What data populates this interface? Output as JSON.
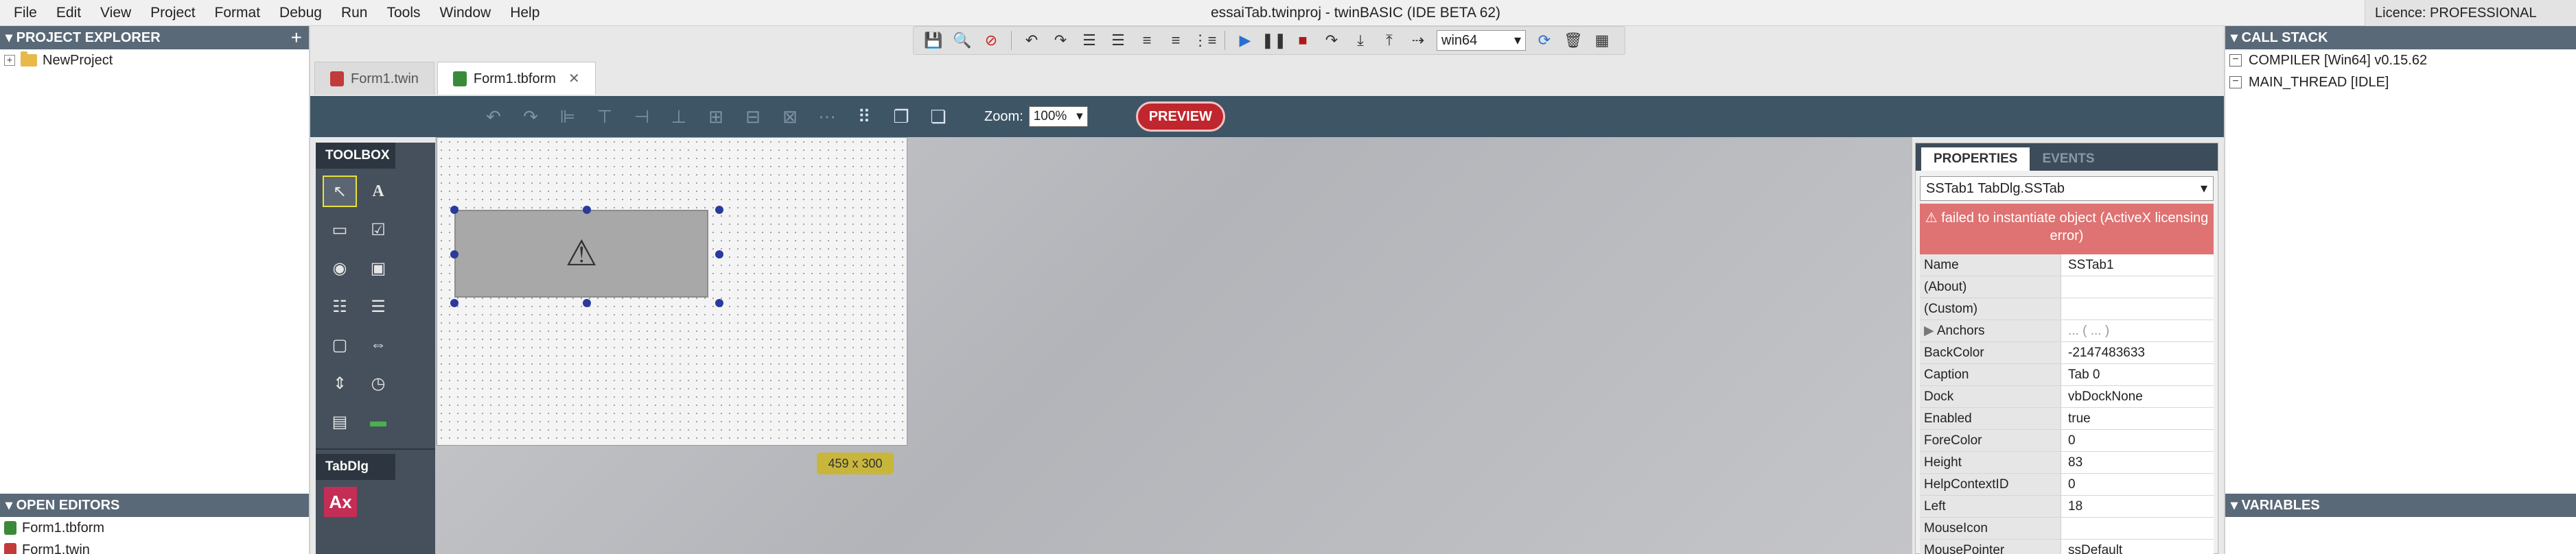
{
  "menu": [
    "File",
    "Edit",
    "View",
    "Project",
    "Format",
    "Debug",
    "Run",
    "Tools",
    "Window",
    "Help"
  ],
  "window_title": "essaiTab.twinproj - twinBASIC (IDE BETA 62)",
  "licence": "Licence: PROFESSIONAL",
  "project_explorer": {
    "title": "PROJECT EXPLORER",
    "add_icon": "+",
    "root": "NewProject"
  },
  "open_editors": {
    "title": "OPEN EDITORS",
    "items": [
      "Form1.tbform",
      "Form1.twin"
    ]
  },
  "toolbar": {
    "platform": "win64"
  },
  "editor_tabs": [
    {
      "label": "Form1.twin",
      "active": false
    },
    {
      "label": "Form1.tbform",
      "active": true,
      "close": "✕"
    }
  ],
  "designer": {
    "zoom_label": "Zoom:",
    "zoom_value": "100%",
    "preview_label": "PREVIEW"
  },
  "toolbox": {
    "title": "TOOLBOX",
    "section": "TabDlg",
    "section_item": "Ax"
  },
  "form": {
    "size_badge": "459 x 300"
  },
  "properties": {
    "tabs": [
      "PROPERTIES",
      "EVENTS"
    ],
    "object": "SSTab1    TabDlg.SSTab",
    "error": "⚠ failed to instantiate object (ActiveX licensing error)",
    "rows": [
      {
        "name": "Name",
        "value": "SSTab1"
      },
      {
        "name": "(About)",
        "value": ""
      },
      {
        "name": "(Custom)",
        "value": ""
      },
      {
        "name": "Anchors",
        "value": "... ( ... )"
      },
      {
        "name": "BackColor",
        "value": "-2147483633"
      },
      {
        "name": "Caption",
        "value": "Tab 0"
      },
      {
        "name": "Dock",
        "value": "vbDockNone"
      },
      {
        "name": "Enabled",
        "value": "true"
      },
      {
        "name": "ForeColor",
        "value": "0"
      },
      {
        "name": "Height",
        "value": "83"
      },
      {
        "name": "HelpContextID",
        "value": "0"
      },
      {
        "name": "Left",
        "value": "18"
      },
      {
        "name": "MouseIcon",
        "value": ""
      },
      {
        "name": "MousePointer",
        "value": "ssDefault"
      }
    ]
  },
  "call_stack": {
    "title": "CALL STACK",
    "items": [
      "COMPILER [Win64] v0.15.62",
      "MAIN_THREAD [IDLE]"
    ]
  },
  "variables": {
    "title": "VARIABLES"
  },
  "colors": {
    "accent_dark": "#3e5566",
    "preview_red": "#c0262d",
    "error_red": "#df7272",
    "handle_blue": "#2a3a9c"
  }
}
